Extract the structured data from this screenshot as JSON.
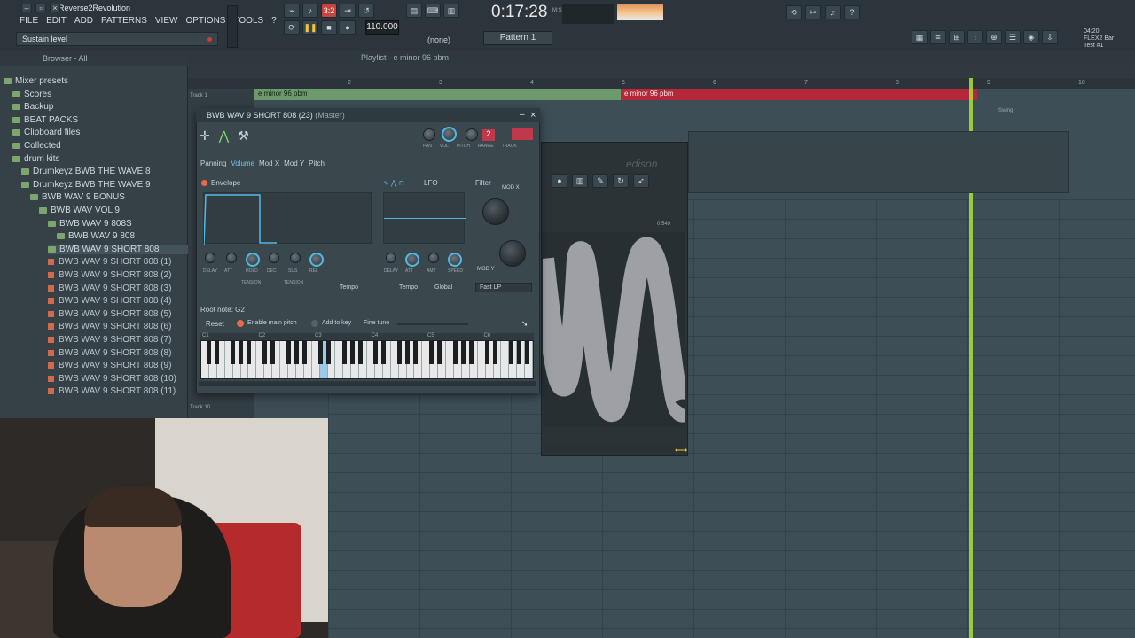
{
  "app": {
    "title": "Reverse2Revolution",
    "hint": "Sustain level",
    "menu": [
      "FILE",
      "EDIT",
      "ADD",
      "PATTERNS",
      "VIEW",
      "OPTIONS",
      "TOOLS",
      "?"
    ],
    "tempo": "110.000",
    "time": "0:17:28",
    "time_unit": "M:S:CS",
    "pattern": "Pattern 1",
    "none": "(none)",
    "counter": "3:2",
    "project_lines": [
      "04:20",
      "FLEX2 Bar",
      "Test #1"
    ]
  },
  "browser": {
    "header": "Browser - All",
    "items": [
      {
        "label": "Mixer presets",
        "type": "folder"
      },
      {
        "label": "Scores",
        "type": "folder"
      },
      {
        "label": "Backup",
        "type": "folder"
      },
      {
        "label": "BEAT PACKS",
        "type": "folder"
      },
      {
        "label": "Clipboard files",
        "type": "folder"
      },
      {
        "label": "Collected",
        "type": "folder"
      },
      {
        "label": "drum kits",
        "type": "folder"
      },
      {
        "label": "Drumkeyz BWB THE WAVE 8",
        "type": "folder"
      },
      {
        "label": "Drumkeyz BWB THE WAVE 9",
        "type": "folder"
      },
      {
        "label": "BWB WAV 9 BONUS",
        "type": "folder"
      },
      {
        "label": "BWB WAV VOL 9",
        "type": "folder"
      },
      {
        "label": "BWB WAV 9 808S",
        "type": "folder"
      },
      {
        "label": "BWB WAV 9 808",
        "type": "folder"
      },
      {
        "label": "BWB WAV 9 SHORT 808",
        "type": "folder"
      },
      {
        "label": "BWB WAV 9 SHORT 808 (1)",
        "type": "file"
      },
      {
        "label": "BWB WAV 9 SHORT 808 (2)",
        "type": "file"
      },
      {
        "label": "BWB WAV 9 SHORT 808 (3)",
        "type": "file"
      },
      {
        "label": "BWB WAV 9 SHORT 808 (4)",
        "type": "file"
      },
      {
        "label": "BWB WAV 9 SHORT 808 (5)",
        "type": "file"
      },
      {
        "label": "BWB WAV 9 SHORT 808 (6)",
        "type": "file"
      },
      {
        "label": "BWB WAV 9 SHORT 808 (7)",
        "type": "file"
      },
      {
        "label": "BWB WAV 9 SHORT 808 (8)",
        "type": "file"
      },
      {
        "label": "BWB WAV 9 SHORT 808 (9)",
        "type": "file"
      },
      {
        "label": "BWB WAV 9 SHORT 808 (10)",
        "type": "file"
      },
      {
        "label": "BWB WAV 9 SHORT 808 (11)",
        "type": "file"
      }
    ]
  },
  "playlist": {
    "title": "Playlist - e minor 96 pbm",
    "clip1": "e minor 96 pbm",
    "clip2": "e minor 96 pbm",
    "ruler": [
      "2",
      "3",
      "4",
      "5",
      "6",
      "7",
      "8",
      "9",
      "10"
    ],
    "track1": "Track 1",
    "track10": "Track 10",
    "swing": "Swing"
  },
  "channel": {
    "title": "BWB WAV 9 SHORT 808 (23)",
    "master": "(Master)",
    "tabs": [
      "Panning",
      "Volume",
      "Mod X",
      "Mod Y",
      "Pitch"
    ],
    "envelope": "Envelope",
    "lfo": "LFO",
    "filter": "Filter",
    "mod_x": "MOD X",
    "mod_y": "MOD Y",
    "tempo": "Tempo",
    "global": "Global",
    "fast_lp": "Fast LP",
    "root": "Root note: G2",
    "reset": "Reset",
    "enable_pitch": "Enable main pitch",
    "add_key": "Add to key",
    "fine_tune": "Fine tune",
    "track_num": "2",
    "top_knobs": [
      "PAN",
      "VOL",
      "PITCH",
      "RANGE",
      "TRACK"
    ],
    "env_knobs": [
      "DELAY",
      "ATT",
      "HOLD",
      "DEC",
      "SUS",
      "REL"
    ],
    "lfo_knobs": [
      "DELAY",
      "ATT",
      "AMT",
      "SPEED"
    ],
    "tension": "TENSION",
    "octaves": [
      "C1",
      "C2",
      "C3",
      "C4",
      "C5",
      "C6"
    ]
  },
  "edison": {
    "title": "edison",
    "time": "0:549"
  }
}
